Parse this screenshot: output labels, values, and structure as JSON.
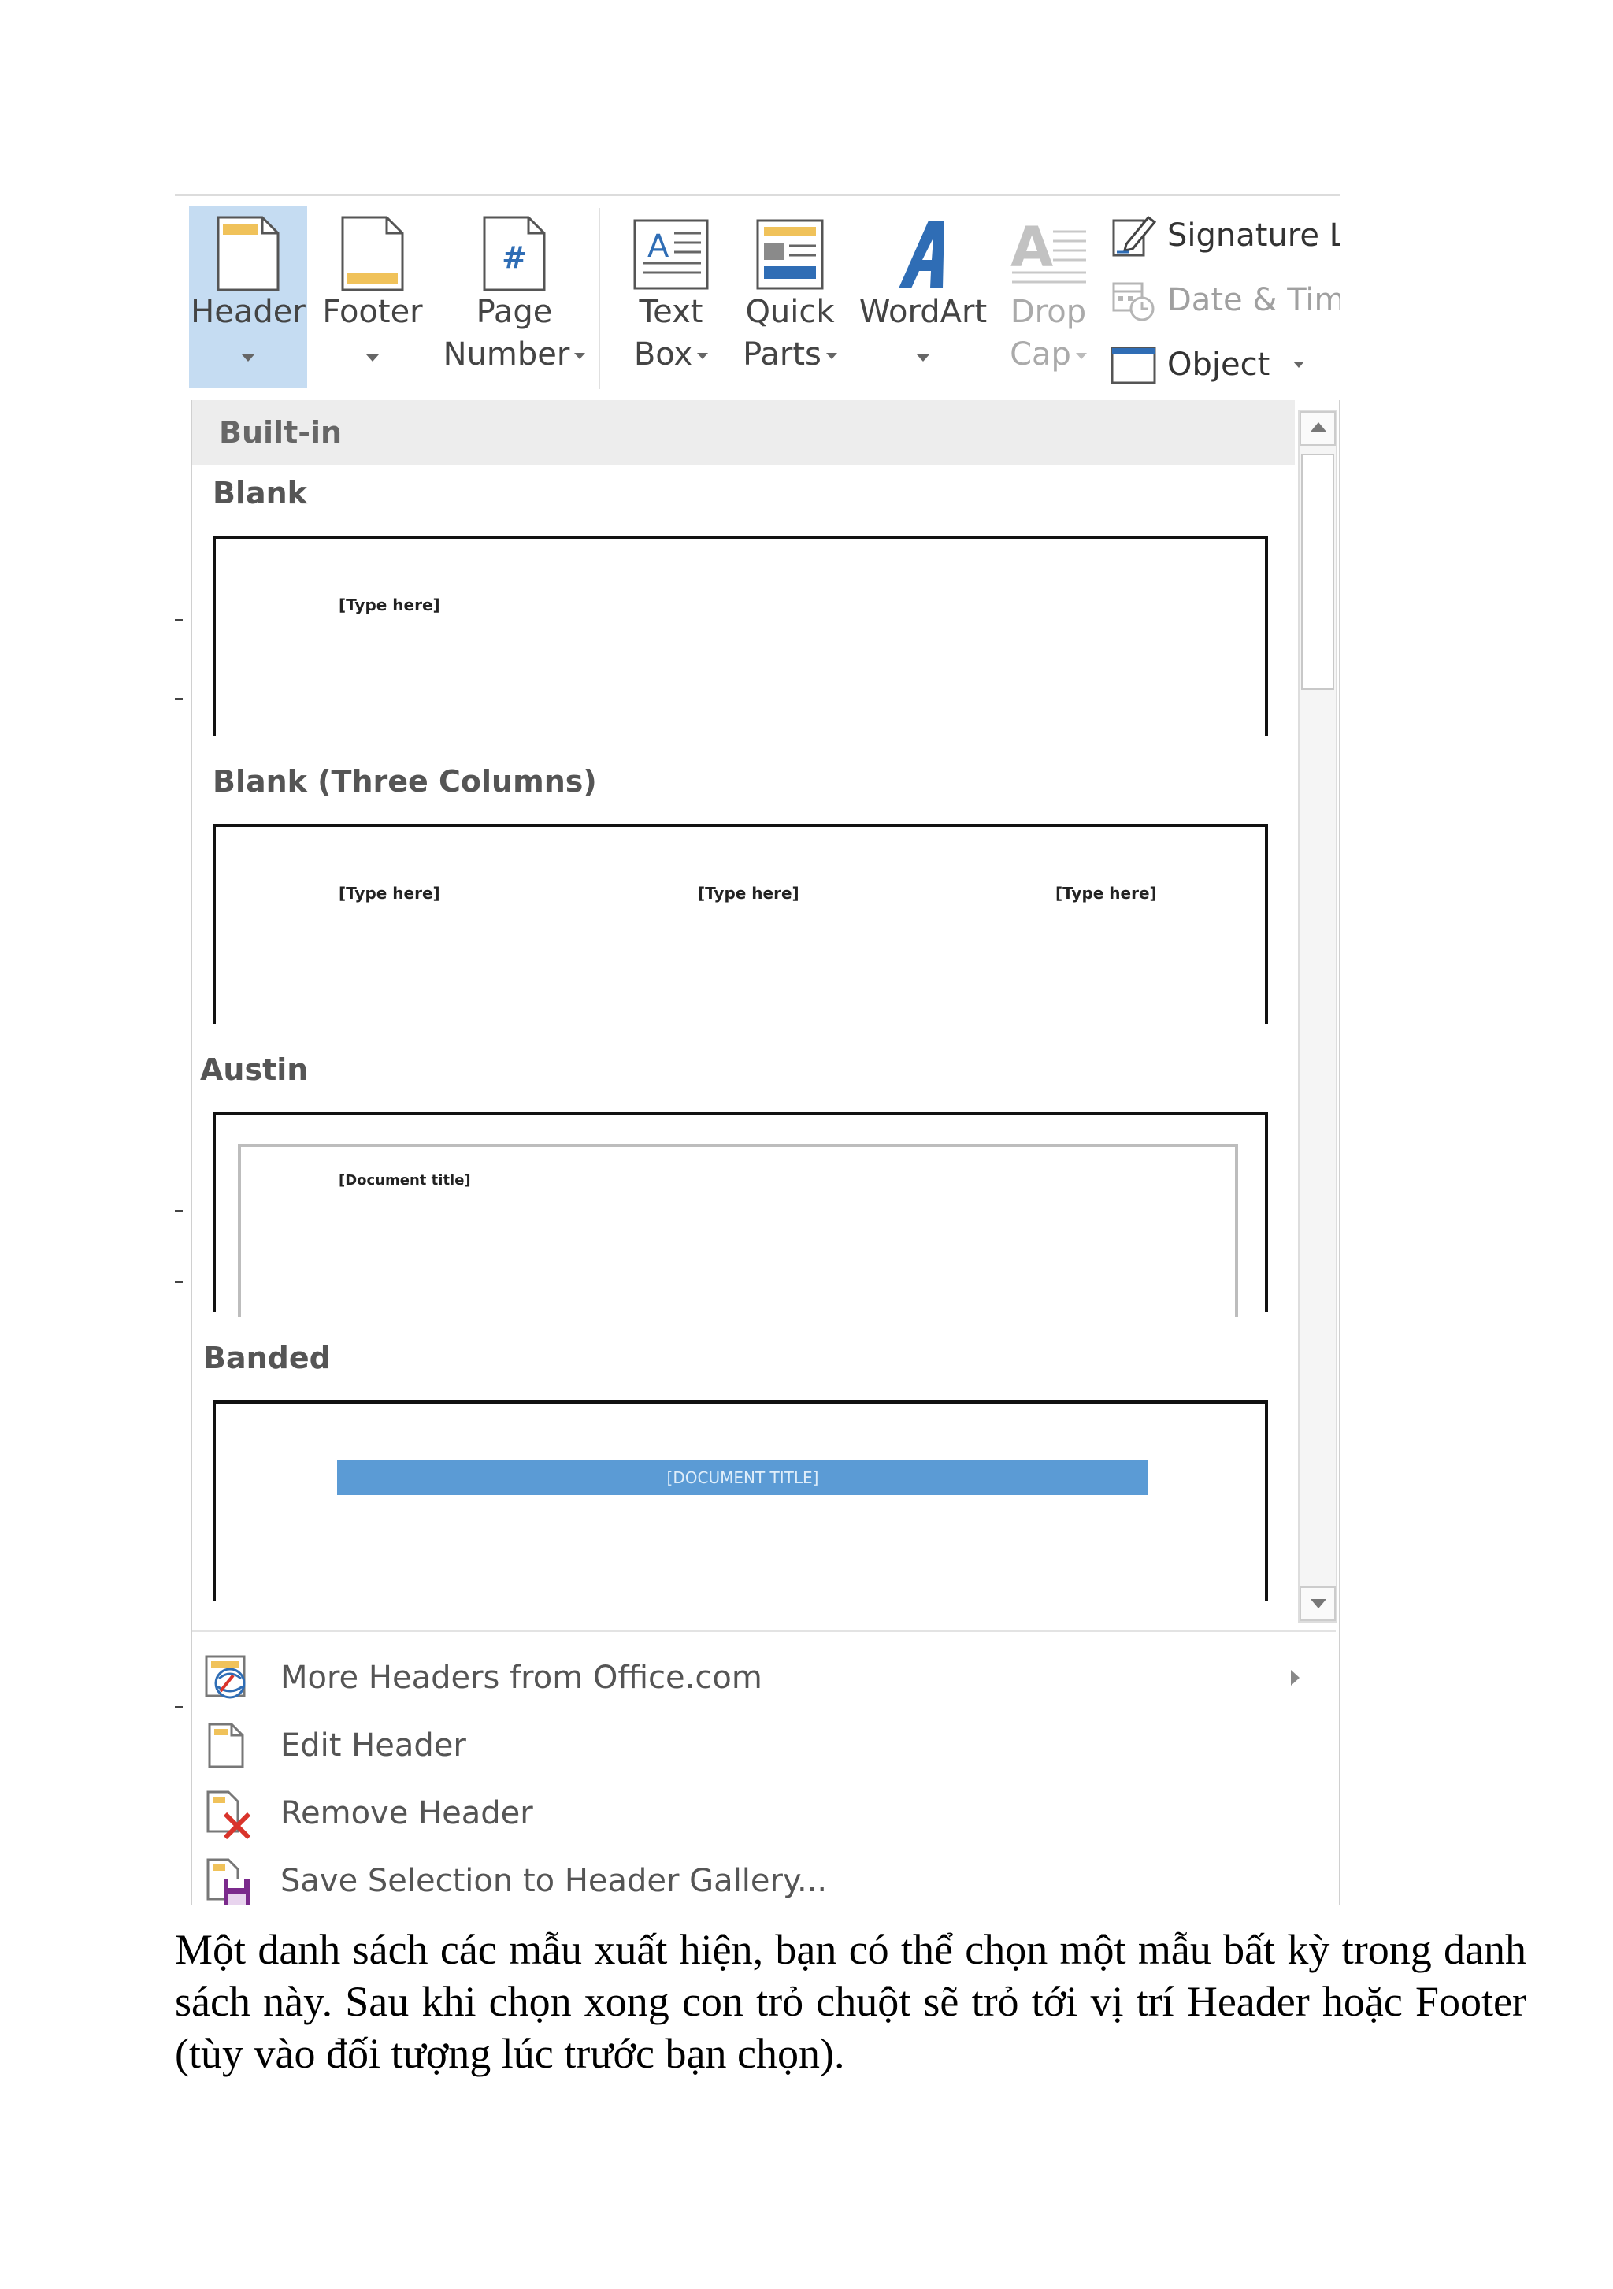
{
  "ribbon": {
    "header": {
      "line1": "Header"
    },
    "footer": {
      "line1": "Footer"
    },
    "page_number": {
      "line1": "Page",
      "line2": "Number"
    },
    "text_box": {
      "line1": "Text",
      "line2": "Box"
    },
    "quick_parts": {
      "line1": "Quick",
      "line2": "Parts"
    },
    "wordart": {
      "line1": "WordArt"
    },
    "drop_cap": {
      "line1": "Drop",
      "line2": "Cap"
    },
    "signature_line": "Signature Li",
    "date_time": "Date & Tim",
    "object": "Object"
  },
  "gallery": {
    "section_label": "Built-in",
    "items": [
      {
        "title": "Blank",
        "placeholders": [
          "[Type here]"
        ]
      },
      {
        "title": "Blank (Three Columns)",
        "placeholders": [
          "[Type here]",
          "[Type here]",
          "[Type here]"
        ]
      },
      {
        "title": "Austin",
        "placeholders": [
          "[Document title]"
        ]
      },
      {
        "title": "Banded",
        "placeholders": [
          "[DOCUMENT TITLE]"
        ]
      }
    ]
  },
  "menu": {
    "more_headers": "More Headers from Office.com",
    "edit_header": "Edit Header",
    "remove_header": "Remove Header",
    "save_selection": "Save Selection to Header Gallery..."
  },
  "caption": "Một danh sách các mẫu xuất hiện, bạn có thể chọn một mẫu bất kỳ trong danh sách này. Sau khi chọn xong con trỏ chuột sẽ trỏ tới vị trí Header hoặc Footer (tùy vào đối tượng lúc trước bạn chọn).",
  "colors": {
    "ribbon_active": "#c5dcf2",
    "banded_bar": "#5b9bd5",
    "accent_blue": "#2f6db5",
    "remove_red": "#d9342b",
    "save_purple": "#7b2a8c"
  }
}
